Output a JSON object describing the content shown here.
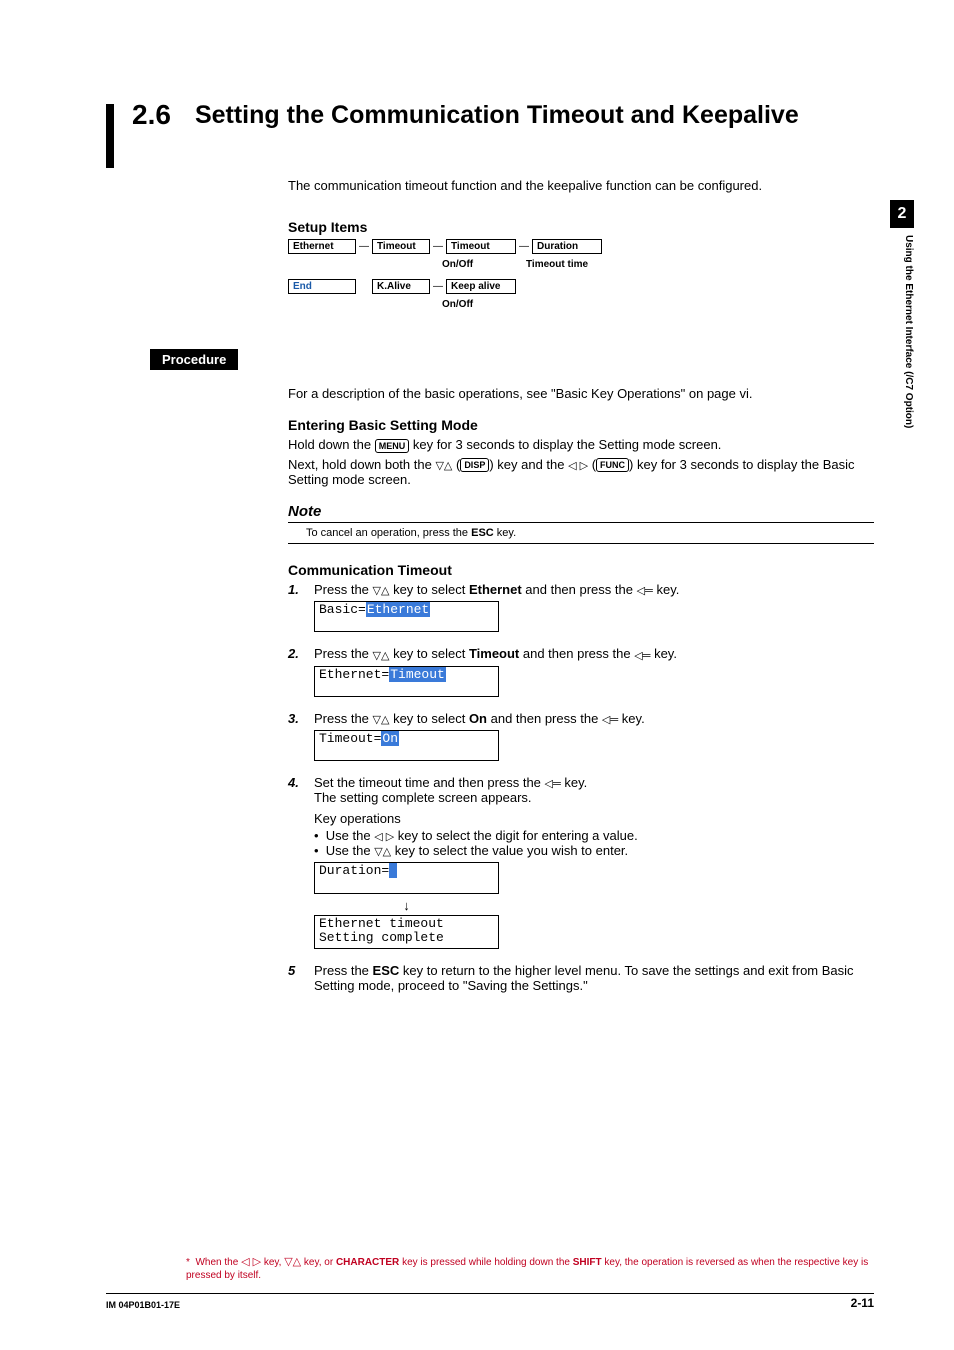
{
  "side": {
    "chapter": "2",
    "label": "Using the Ethernet Interface (/C7 Option)"
  },
  "title": {
    "num": "2.6",
    "text": "Setting the Communication Timeout and Keepalive"
  },
  "intro": "The communication timeout function and the keepalive function can be configured.",
  "setup": {
    "heading": "Setup Items",
    "row1": {
      "ethernet": "Ethernet",
      "timeout": "Timeout",
      "timeout2": "Timeout",
      "timeout2_sub": "On/Off",
      "duration": "Duration",
      "duration_sub": "Timeout time"
    },
    "row2": {
      "end": "End",
      "kalive": "K.Alive",
      "keepalive": "Keep alive",
      "keepalive_sub": "On/Off"
    }
  },
  "procedure_label": "Procedure",
  "basic_ops": "For a description of the basic operations, see \"Basic Key Operations\" on page vi.",
  "enter_mode": {
    "heading": "Entering Basic Setting Mode",
    "l1a": "Hold down the ",
    "menu": "MENU",
    "l1b": " key for 3 seconds to display the Setting mode screen.",
    "l2a": "Next, hold down both the ",
    "disp": "DISP",
    "l2b": ") key and the ",
    "func": "FUNC",
    "l2c": ") key for 3 seconds to display the Basic Setting mode screen."
  },
  "note": {
    "heading": "Note",
    "body_a": "To cancel an operation, press the ",
    "esc": "ESC",
    "body_b": " key."
  },
  "comm": {
    "heading": "Communication Timeout",
    "s1a": "Press the ",
    "s1b": " key to select ",
    "ethernet": "Ethernet",
    "s1c": " and then press the ",
    "s1d": " key.",
    "lcd1_a": "Basic=",
    "lcd1_b": "Ethernet",
    "s2b": " key to select ",
    "timeout": "Timeout",
    "lcd2_a": "Ethernet=",
    "lcd2_b": "Timeout",
    "on": "On",
    "lcd3_a": "Timeout=",
    "lcd3_b": "On",
    "s4a": "Set the timeout time and then press the ",
    "s4b": " key.",
    "s4c": "The setting complete screen appears.",
    "keyops": "Key operations",
    "b1a": "Use the ",
    "b1b": " key to select the digit for entering a value.",
    "b2b": " key to select the value you wish to enter.",
    "lcd4_a": "Duration=",
    "lcd5_a": "Ethernet timeout",
    "lcd5_b": "Setting complete",
    "s5a": "Press the ",
    "s5esc": "ESC",
    "s5b": " key to return to the higher level menu. To save the settings and exit from Basic Setting mode, proceed to \"Saving the Settings.\""
  },
  "steps": {
    "n1": "1.",
    "n2": "2.",
    "n3": "3.",
    "n4": "4.",
    "n5": "5"
  },
  "footnote": {
    "star": "*",
    "a": "When the ",
    "b": " key, ",
    "c": " key, or ",
    "char": "CHARACTER",
    "d": " key is pressed while holding down the ",
    "shift": "SHIFT",
    "e": " key, the operation is reversed as when the respective key is pressed alone by itself.",
    "e2": " key, the operation is reversed as when the respective key is pressed by itself."
  },
  "footer": {
    "left": "IM 04P01B01-17E",
    "right": "2-11"
  }
}
